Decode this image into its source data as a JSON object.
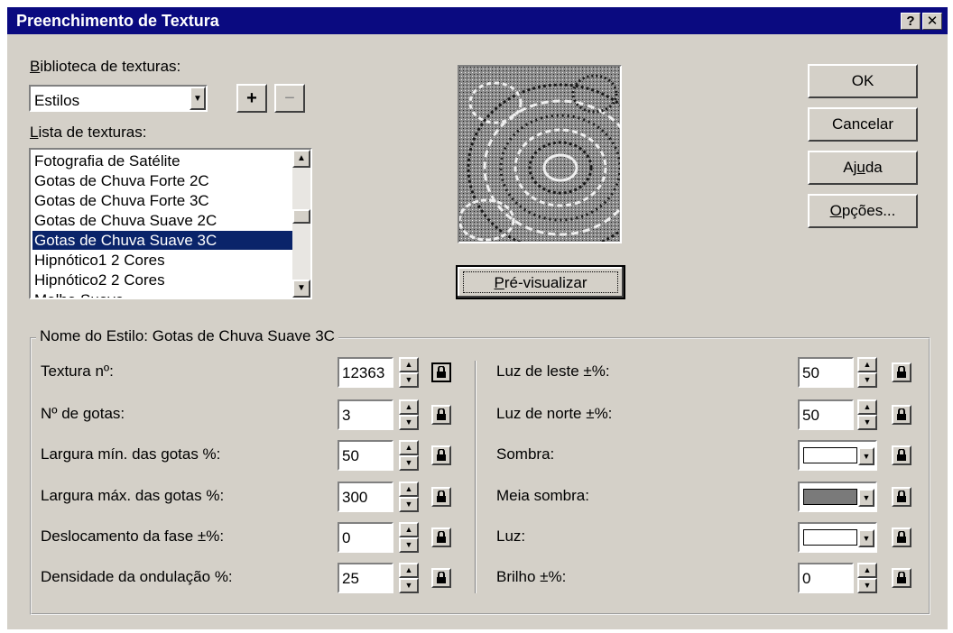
{
  "window": {
    "title": "Preenchimento de Textura",
    "help_btn": "?",
    "close_btn": "✕"
  },
  "library": {
    "label_underline": "B",
    "label_rest": "iblioteca de texturas:",
    "selected": "Estilos",
    "add_btn": "+",
    "remove_btn": "−"
  },
  "list": {
    "label_underline": "L",
    "label_rest": "ista de texturas:",
    "items": [
      "Fotografia de Satélite",
      "Gotas de Chuva Forte 2C",
      "Gotas de Chuva Forte 3C",
      "Gotas de Chuva Suave 2C",
      "Gotas de Chuva Suave 3C",
      "Hipnótico1 2 Cores",
      "Hipnótico2 2 Cores",
      "Malha Suave"
    ],
    "selected_index": 4
  },
  "buttons": {
    "ok": "OK",
    "cancel": "Cancelar",
    "help_a": "Aj",
    "help_u": "u",
    "help_b": "da",
    "options_u": "O",
    "options_rest": "pções...",
    "preview_u": "P",
    "preview_rest": "ré-visualizar"
  },
  "style_group": {
    "title": "Nome do Estilo: Gotas de Chuva Suave 3C"
  },
  "left_params": [
    {
      "label": "Textura nº:",
      "value": "12363"
    },
    {
      "label": "Nº de gotas:",
      "value": "3"
    },
    {
      "label": "Largura mín. das gotas %:",
      "value": "50"
    },
    {
      "label": "Largura máx. das gotas %:",
      "value": "300"
    },
    {
      "label": "Deslocamento da fase ±%:",
      "value": "0"
    },
    {
      "label": "Densidade da ondulação %:",
      "value": "25"
    }
  ],
  "right_params": [
    {
      "label": "Luz de leste ±%:",
      "value": "50"
    },
    {
      "label": "Luz de norte ±%:",
      "value": "50"
    },
    {
      "label": "Sombra:",
      "color": "#ffffff"
    },
    {
      "label": "Meia sombra:",
      "color": "#7a7a7a"
    },
    {
      "label": "Luz:",
      "color": "#ffffff"
    },
    {
      "label": "Brilho ±%:",
      "value": "0"
    }
  ],
  "colors": {
    "title_bar": "#0a0a80",
    "selection": "#0a246a",
    "face": "#d4d0c8"
  }
}
